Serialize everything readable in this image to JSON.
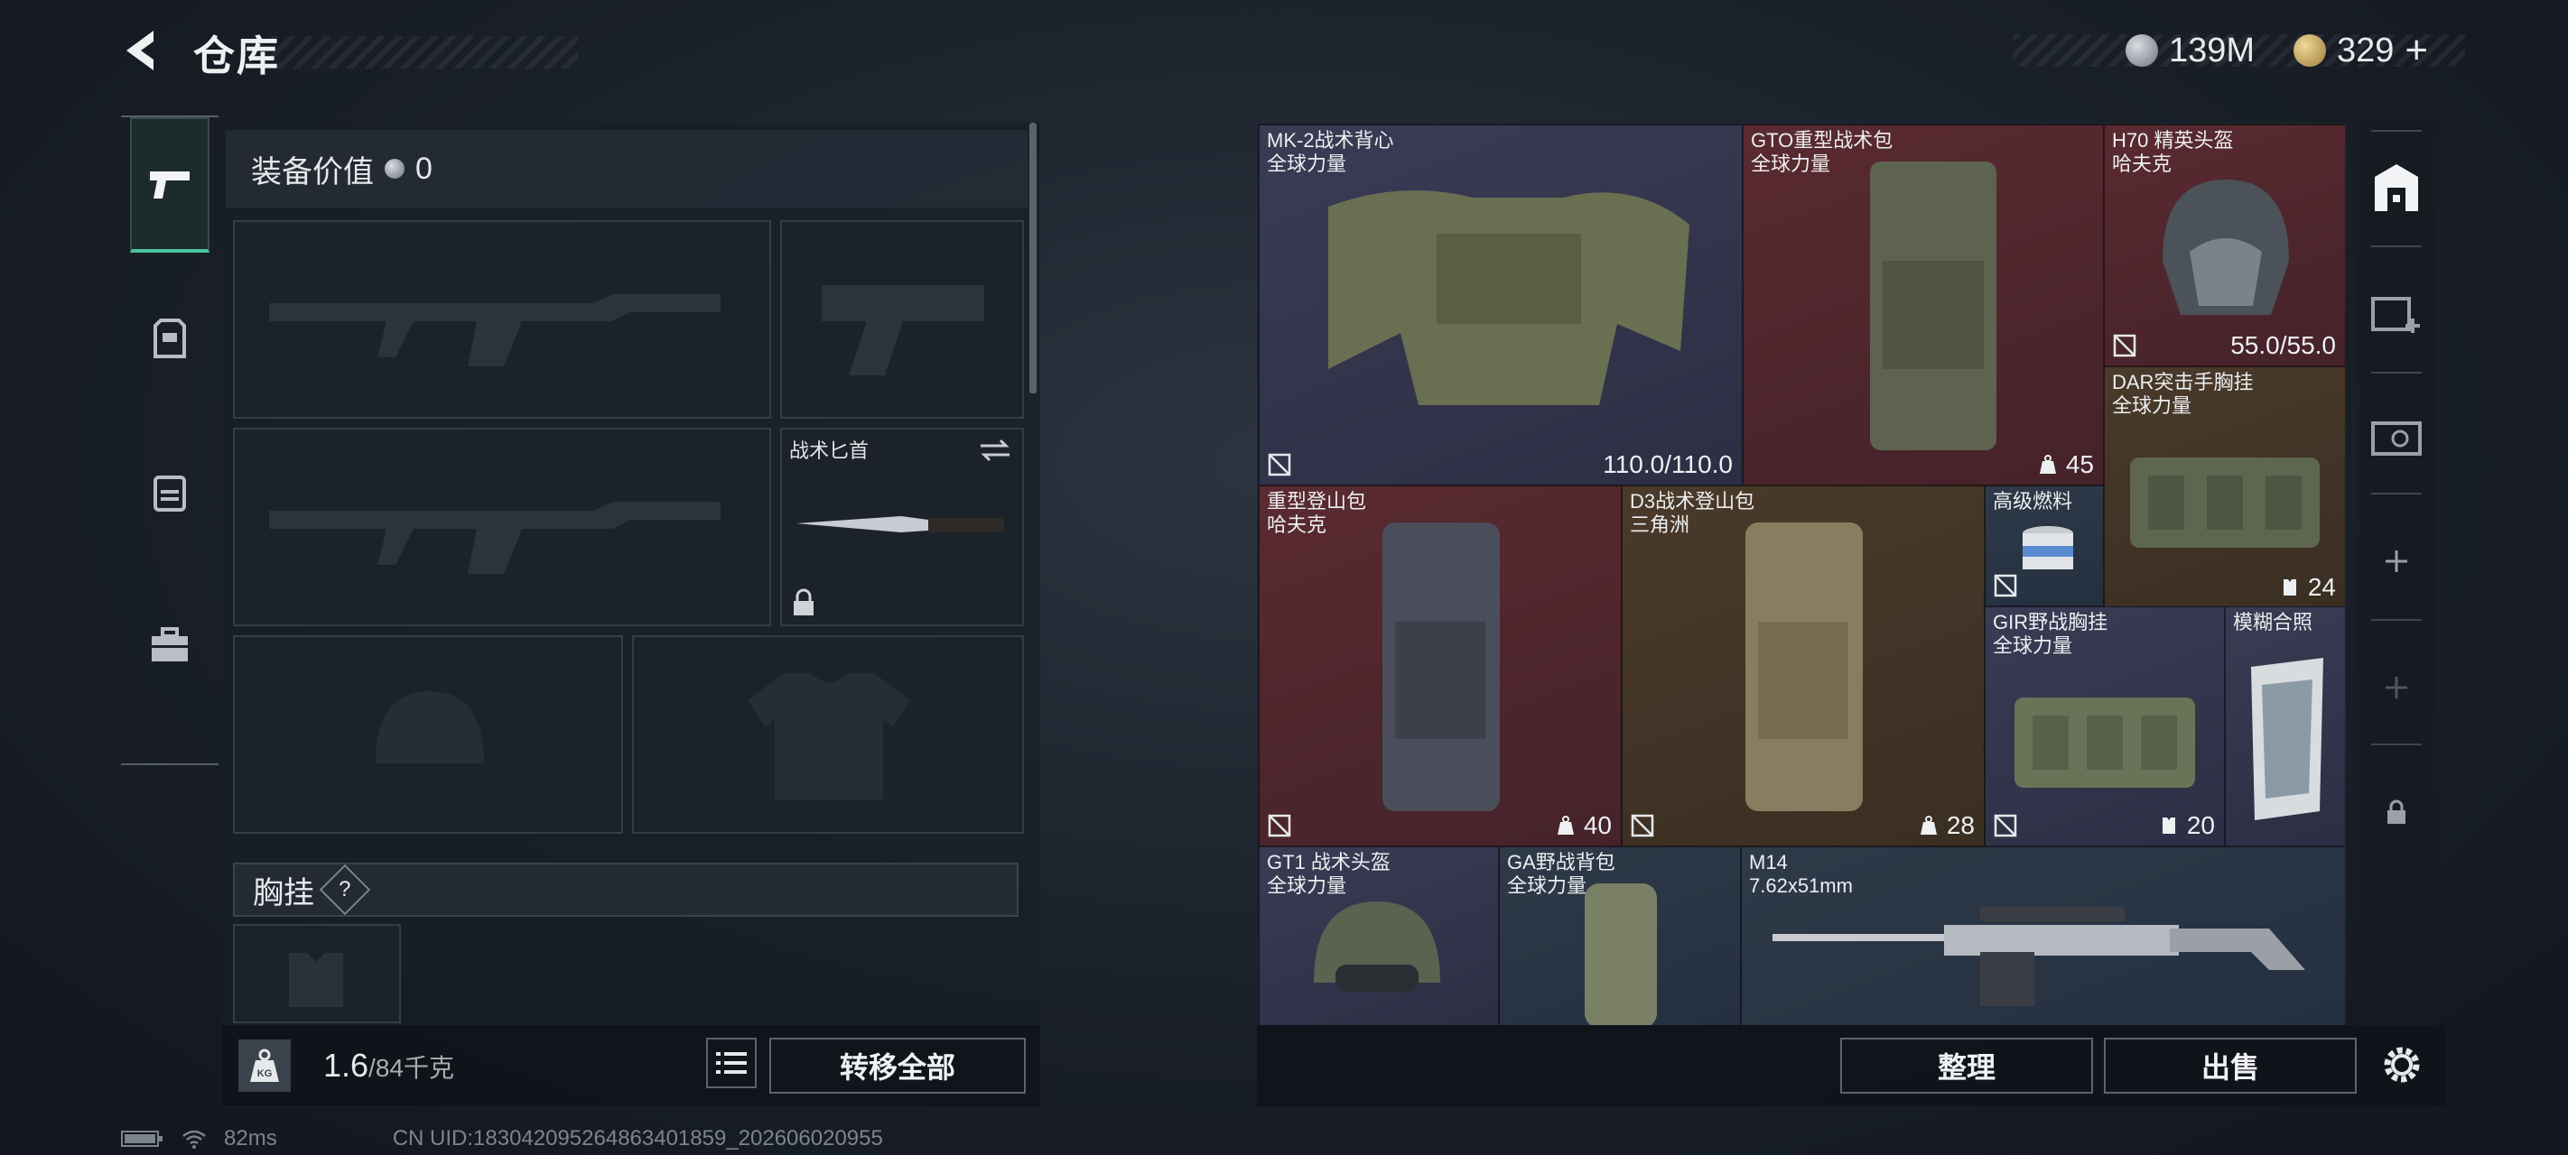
{
  "header": {
    "title": "仓库",
    "currency_a": "139M",
    "currency_b": "329",
    "currency_b_plus": "+"
  },
  "equipment": {
    "value_label": "装备价值",
    "value_amount": "0",
    "knife_label": "战术匕首",
    "section_chest": "胸挂",
    "section_help": "?",
    "weight_current": "1.6",
    "weight_capacity": "/84千克",
    "kg_label": "KG",
    "transfer_all": "转移全部"
  },
  "storage": {
    "items": [
      {
        "name": "MK-2战术背心",
        "sub": "全球力量",
        "stat": "110.0/110.0",
        "bg": "purple"
      },
      {
        "name": "GTO重型战术包",
        "sub": "全球力量",
        "stat": "45",
        "bg": "red"
      },
      {
        "name": "H70 精英头盔",
        "sub": "哈夫克",
        "stat": "55.0/55.0",
        "bg": "red"
      },
      {
        "name": "DAR突击手胸挂",
        "sub": "全球力量",
        "stat": "24",
        "bg": "gold"
      },
      {
        "name": "重型登山包",
        "sub": "哈夫克",
        "stat": "40",
        "bg": "red"
      },
      {
        "name": "D3战术登山包",
        "sub": "三角洲",
        "stat": "28",
        "bg": "gold"
      },
      {
        "name": "高级燃料",
        "sub": "",
        "stat": "",
        "bg": "blue"
      },
      {
        "name": "GIR野战胸挂",
        "sub": "全球力量",
        "stat": "20",
        "bg": "purple"
      },
      {
        "name": "模糊合照",
        "sub": "",
        "stat": "",
        "bg": "purple"
      },
      {
        "name": "GT1 战术头盔",
        "sub": "全球力量",
        "stat": "",
        "bg": "purple"
      },
      {
        "name": "GA野战背包",
        "sub": "全球力量",
        "stat": "",
        "bg": "blue"
      },
      {
        "name": "M14",
        "sub": "7.62x51mm",
        "stat": "",
        "bg": "blue"
      }
    ],
    "sort_label": "整理",
    "sell_label": "出售"
  },
  "status": {
    "ping": "82ms",
    "uid": "CN UID:1830420952648634018​59_202606020955"
  },
  "colors": {
    "accent_green": "#49c6a0",
    "rarity_purple": "#3a3c55",
    "rarity_red": "#5a2a30",
    "rarity_gold": "#4a3a2a",
    "rarity_blue": "#2e3a48"
  }
}
